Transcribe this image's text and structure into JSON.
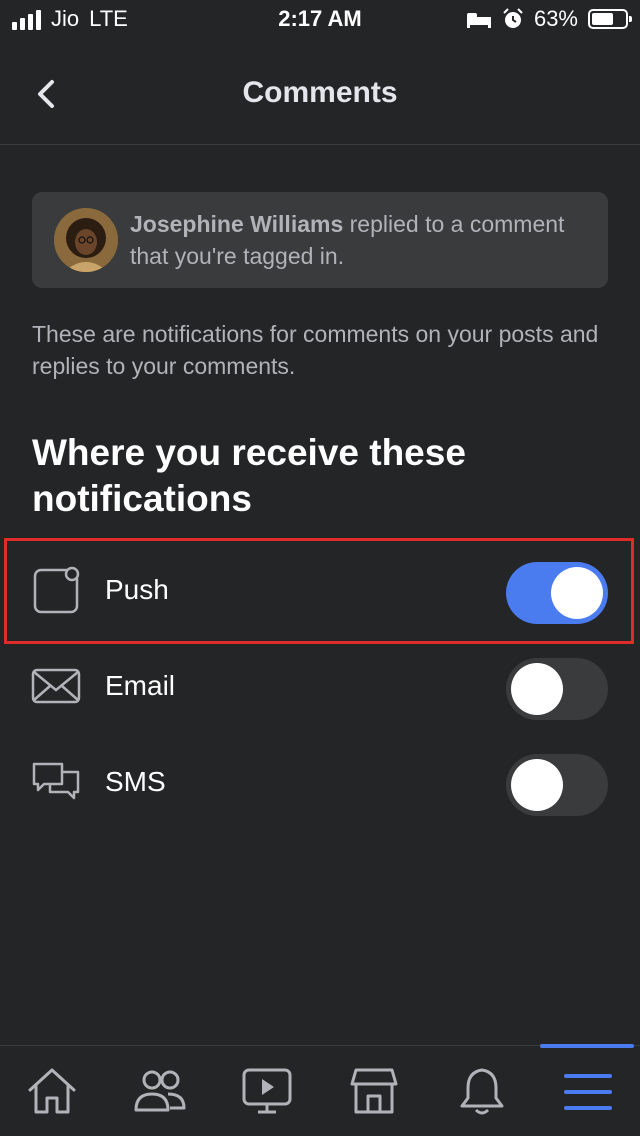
{
  "status_bar": {
    "carrier": "Jio",
    "network": "LTE",
    "time": "2:17 AM",
    "battery": "63%",
    "battery_level": 0.63
  },
  "header": {
    "title": "Comments",
    "back_icon": "chevron-left-icon"
  },
  "preview": {
    "name": "Josephine Williams",
    "message": " replied to a comment that you're tagged in."
  },
  "description": "These are notifications for comments on your posts and replies to your comments.",
  "section_title": "Where you receive these notifications",
  "channels": [
    {
      "label": "Push",
      "icon": "push-notification-icon",
      "enabled": true
    },
    {
      "label": "Email",
      "icon": "envelope-icon",
      "enabled": false
    },
    {
      "label": "SMS",
      "icon": "chat-bubbles-icon",
      "enabled": false
    }
  ],
  "colors": {
    "accent": "#4a7cf0",
    "highlight": "#e02b2b",
    "background": "#242526"
  },
  "bottom_nav": [
    "home-icon",
    "friends-icon",
    "watch-icon",
    "marketplace-icon",
    "bell-icon",
    "menu-icon"
  ]
}
